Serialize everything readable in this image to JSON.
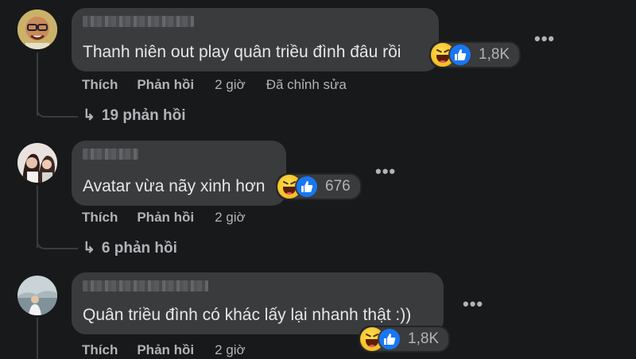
{
  "comments": [
    {
      "text": "Thanh niên out play quân triều đình đâu rồi",
      "reaction_count": "1,8K",
      "like_label": "Thích",
      "reply_label": "Phản hồi",
      "time": "2 giờ",
      "edited": "Đã chỉnh sửa",
      "replies_label": "19 phản hồi"
    },
    {
      "text": "Avatar vừa nãy xinh hơn",
      "reaction_count": "676",
      "like_label": "Thích",
      "reply_label": "Phản hồi",
      "time": "2 giờ",
      "replies_label": "6 phản hồi"
    },
    {
      "text": "Quân triều đình có khác lấy lại nhanh thật :))",
      "reaction_count": "1,8K",
      "like_label": "Thích",
      "reply_label": "Phản hồi",
      "time": "2 giờ"
    }
  ],
  "icons": {
    "more": "more-options-icon",
    "reply_arrow": "reply-arrow-icon",
    "haha": "haha-reaction-icon",
    "like": "like-reaction-icon"
  },
  "colors": {
    "background": "#18191a",
    "bubble": "#3a3b3c",
    "text": "#e4e6eb",
    "secondary": "#b0b3b8",
    "like_blue": "#1877f2"
  },
  "more_glyph": "•••",
  "reply_glyph": "↳"
}
